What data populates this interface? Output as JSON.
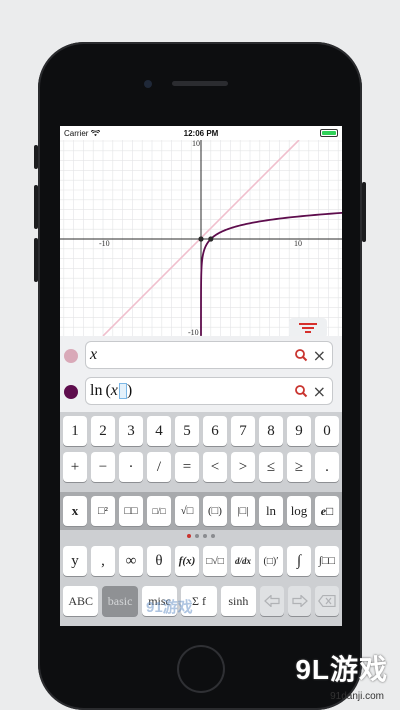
{
  "status_bar": {
    "carrier": "Carrier",
    "time": "12:06 PM"
  },
  "graph": {
    "x_ticks": [
      "-10",
      "10"
    ],
    "y_ticks": [
      "10",
      "-10"
    ],
    "curves": [
      {
        "expression": "x",
        "color": "#f0bfcd"
      },
      {
        "expression": "ln(x)",
        "color": "#5e0d4d"
      }
    ],
    "menu_icon": "filter-lines-icon",
    "menu_color": "#d6302c"
  },
  "expressions": [
    {
      "text": "x",
      "dot_color": "#d9a9b8"
    },
    {
      "prefix": "ln",
      "open": "(",
      "var": "x",
      "close": ")",
      "dot_color": "#5e0d4d"
    }
  ],
  "keys": {
    "row1": [
      "1",
      "2",
      "3",
      "4",
      "5",
      "6",
      "7",
      "8",
      "9",
      "0"
    ],
    "row2": [
      "+",
      "−",
      "·",
      "/",
      "=",
      "<",
      ">",
      "≤",
      "≥",
      "."
    ],
    "row3": [
      "x",
      "□²",
      "□□",
      "□/□",
      "√□",
      "(□)",
      "|□|",
      "ln",
      "log",
      "e□"
    ],
    "row4": [
      "y",
      ",",
      "∞",
      "θ",
      "f(x)",
      "□√□",
      "d/dx",
      "(□)′",
      "∫",
      "∫□□"
    ],
    "mode_labels": [
      "ABC",
      "basic",
      "misc",
      "Σ f",
      "sinh"
    ],
    "nav": [
      "left-arrow-icon",
      "right-arrow-icon",
      "backspace-icon"
    ]
  },
  "page_dots": 4,
  "watermark": {
    "logo": "9L游戏",
    "url": "91danji.com",
    "center_text": "91游戏"
  }
}
